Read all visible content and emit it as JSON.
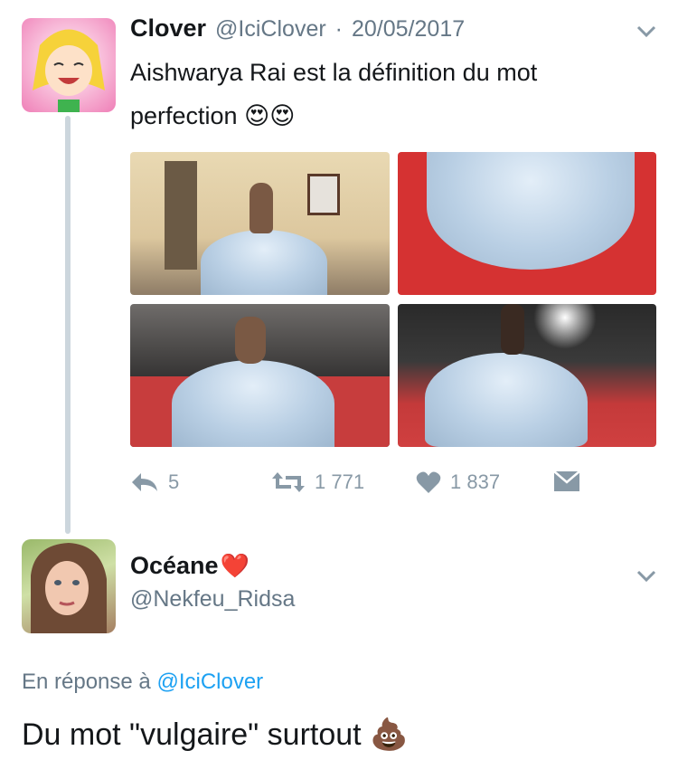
{
  "tweet": {
    "author_name": "Clover",
    "author_handle": "@IciClover",
    "date_sep": "·",
    "date": "20/05/2017",
    "text_line1": "Aishwarya Rai est la définition du mot",
    "text_line2": "perfection",
    "emoji": "😍😍",
    "actions": {
      "reply_count": "5",
      "retweet_count": "1 771",
      "like_count": "1 837"
    },
    "icons": {
      "menu": "chevron-down-icon",
      "reply": "reply-icon",
      "retweet": "retweet-icon",
      "like": "heart-icon",
      "message": "envelope-icon"
    }
  },
  "reply": {
    "author_name": "Océane",
    "author_emoji": "❤️",
    "author_handle": "@Nekfeu_Ridsa",
    "in_reply_prefix": "En réponse à",
    "in_reply_handle": "@IciClover",
    "text": "Du mot \"vulgaire\" surtout",
    "emoji": "💩"
  },
  "colors": {
    "text_primary": "#14171a",
    "text_secondary": "#657786",
    "link": "#1da1f2",
    "icon": "#8899a6",
    "thread_line": "#ccd6dd"
  }
}
